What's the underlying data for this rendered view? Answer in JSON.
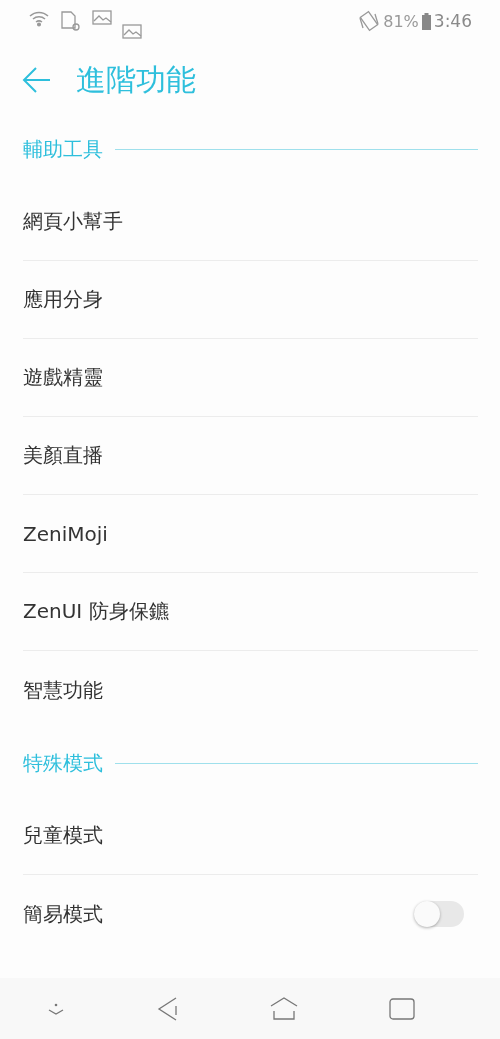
{
  "status_bar": {
    "battery": "81%",
    "time": "3:46"
  },
  "app_bar": {
    "title": "進階功能"
  },
  "sections": [
    {
      "title": "輔助工具",
      "items": [
        {
          "kind": "link",
          "label": "網頁小幫手"
        },
        {
          "kind": "link",
          "label": "應用分身"
        },
        {
          "kind": "link",
          "label": "遊戲精靈"
        },
        {
          "kind": "link",
          "label": "美顏直播"
        },
        {
          "kind": "link",
          "label": "ZeniMoji"
        },
        {
          "kind": "link",
          "label": "ZenUI 防身保鑣"
        },
        {
          "kind": "link",
          "label": "智慧功能"
        }
      ]
    },
    {
      "title": "特殊模式",
      "items": [
        {
          "kind": "link",
          "label": "兒童模式"
        },
        {
          "kind": "toggle",
          "label": "簡易模式",
          "on": false
        }
      ]
    }
  ]
}
